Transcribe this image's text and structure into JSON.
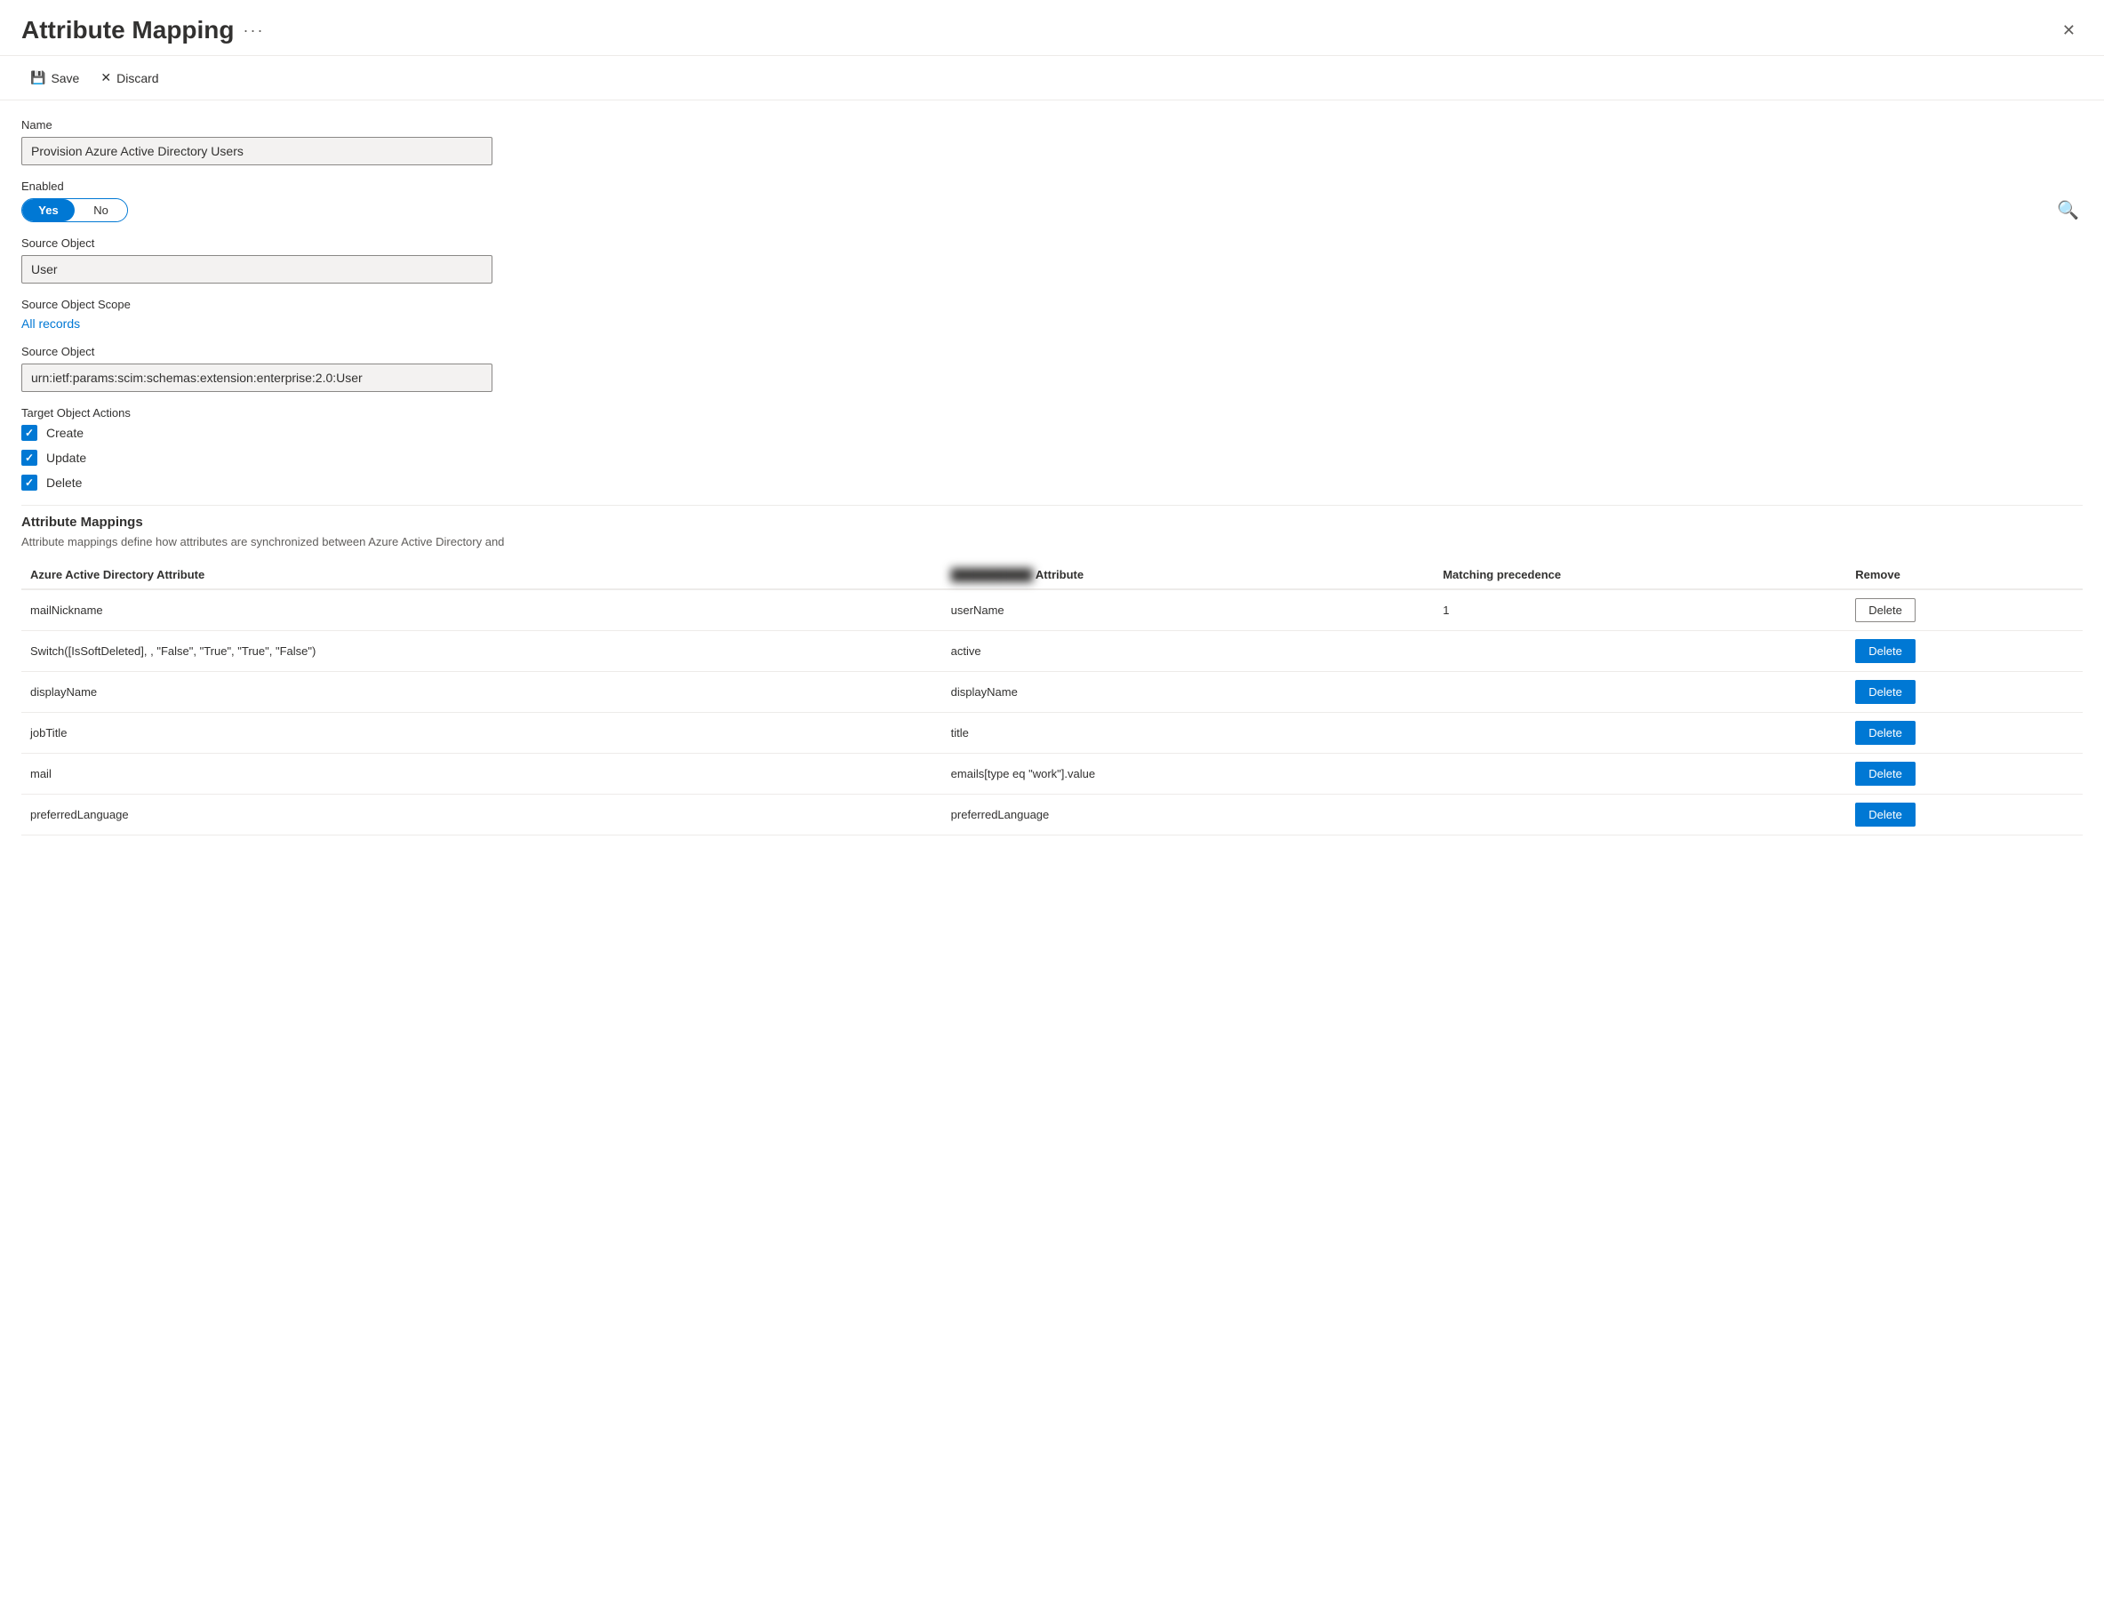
{
  "dialog": {
    "title": "Attribute Mapping",
    "more_label": "···",
    "close_label": "✕"
  },
  "toolbar": {
    "save_label": "Save",
    "discard_label": "Discard"
  },
  "form": {
    "name_label": "Name",
    "name_value": "Provision Azure Active Directory Users",
    "enabled_label": "Enabled",
    "toggle_yes": "Yes",
    "toggle_no": "No",
    "source_object_label": "Source Object",
    "source_object_value": "User",
    "source_scope_label": "Source Object Scope",
    "source_scope_link": "All records",
    "target_object_label": "Source Object",
    "target_object_value": "urn:ietf:params:scim:schemas:extension:enterprise:2.0:User",
    "target_actions_label": "Target Object Actions",
    "actions": [
      {
        "label": "Create",
        "checked": true
      },
      {
        "label": "Update",
        "checked": true
      },
      {
        "label": "Delete",
        "checked": true
      }
    ]
  },
  "attribute_mappings": {
    "section_title": "Attribute Mappings",
    "section_desc": "Attribute mappings define how attributes are synchronized between Azure Active Directory and",
    "blurred_text": "██████████",
    "columns": {
      "aad": "Azure Active Directory Attribute",
      "target": "Attribute",
      "precedence": "Matching precedence",
      "remove": "Remove"
    },
    "rows": [
      {
        "aad": "mailNickname",
        "target": "userName",
        "precedence": "1",
        "delete_style": "outline"
      },
      {
        "aad": "Switch([IsSoftDeleted], , \"False\", \"True\", \"True\", \"False\")",
        "target": "active",
        "precedence": "",
        "delete_style": "filled"
      },
      {
        "aad": "displayName",
        "target": "displayName",
        "precedence": "",
        "delete_style": "filled"
      },
      {
        "aad": "jobTitle",
        "target": "title",
        "precedence": "",
        "delete_style": "filled"
      },
      {
        "aad": "mail",
        "target": "emails[type eq \"work\"].value",
        "precedence": "",
        "delete_style": "filled"
      },
      {
        "aad": "preferredLanguage",
        "target": "preferredLanguage",
        "precedence": "",
        "delete_style": "filled"
      }
    ],
    "delete_label": "Delete"
  }
}
